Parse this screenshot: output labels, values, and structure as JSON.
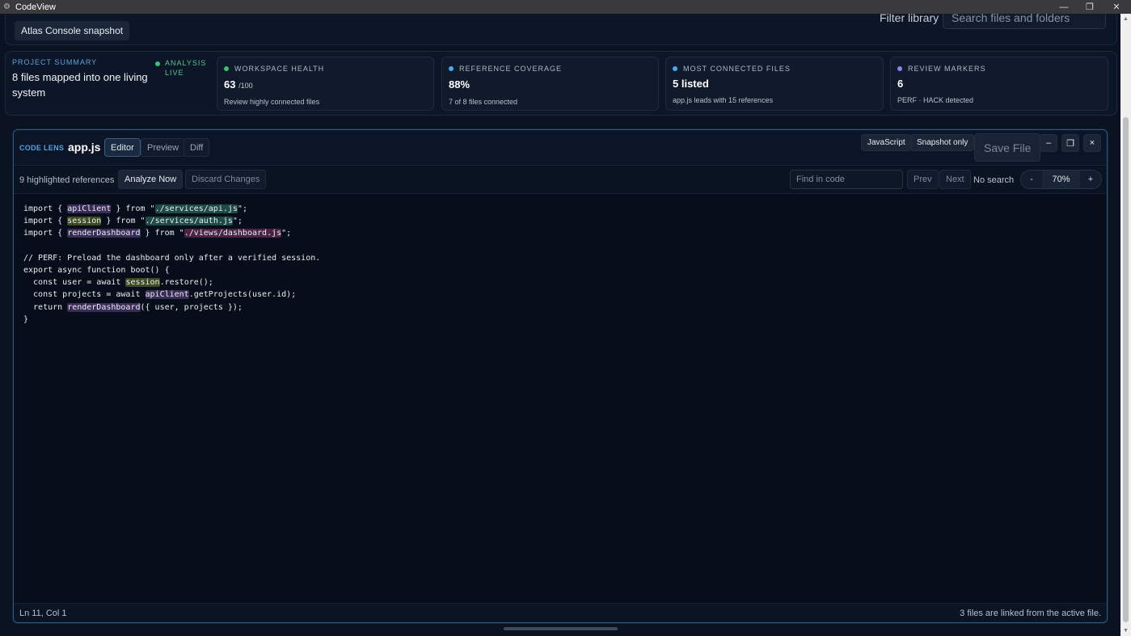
{
  "window": {
    "title": "CodeView"
  },
  "header": {
    "snapshot_chip": "Atlas Console snapshot",
    "filter_label": "Filter library",
    "search_placeholder": "Search files and folders"
  },
  "summary": {
    "eyebrow": "PROJECT SUMMARY",
    "title": "8 files mapped into one living system",
    "live_badge": "ANALYSIS LIVE",
    "cards": [
      {
        "label": "WORKSPACE HEALTH",
        "value": "63",
        "unit": "/100",
        "sub": "Review highly connected files",
        "dot_color": "#39c07a"
      },
      {
        "label": "REFERENCE COVERAGE",
        "value": "88%",
        "unit": "",
        "sub": "7 of 8 files connected",
        "dot_color": "#4aa8ee"
      },
      {
        "label": "MOST CONNECTED FILES",
        "value": "5 listed",
        "unit": "",
        "sub": "app.js leads with 15 references",
        "dot_color": "#4aa8ee"
      },
      {
        "label": "REVIEW MARKERS",
        "value": "6",
        "unit": "",
        "sub": "PERF · HACK detected",
        "dot_color": "#8a86f0"
      }
    ]
  },
  "lens": {
    "label": "CODE LENS",
    "file_name": "app.js",
    "tabs": [
      "Editor",
      "Preview",
      "Diff"
    ],
    "language": "JavaScript",
    "snapshot_only": "Snapshot only",
    "save_label": "Save File",
    "minimize_glyph": "–",
    "restore_glyph": "❐",
    "close_glyph": "×",
    "refs_text": "9 highlighted references",
    "analyze_label": "Analyze Now",
    "discard_label": "Discard Changes",
    "find_placeholder": "Find in code",
    "prev_label": "Prev",
    "next_label": "Next",
    "search_status": "No search",
    "zoom": {
      "minus": "-",
      "value": "70%",
      "plus": "+"
    },
    "status_left": "Ln 11, Col 1",
    "status_right": "3 files are linked from the active file.",
    "code": {
      "l1": [
        "import { ",
        "apiClient",
        " } from \"",
        "./services/api.js",
        "\";"
      ],
      "l2": [
        "import { ",
        "session",
        " } from \"",
        "./services/auth.js",
        "\";"
      ],
      "l3": [
        "import { ",
        "renderDashboard",
        " } from \"",
        "./views/dashboard.js",
        "\";"
      ],
      "l5": "// PERF: Preload the dashboard only after a verified session.",
      "l6": "export async function boot() {",
      "l7": [
        "  const user = await ",
        "session",
        ".restore();"
      ],
      "l8": [
        "  const projects = await ",
        "apiClient",
        ".getProjects(user.id);"
      ],
      "l9": [
        "  return ",
        "renderDashboard",
        "({ user, projects });"
      ],
      "l10": "}"
    }
  }
}
